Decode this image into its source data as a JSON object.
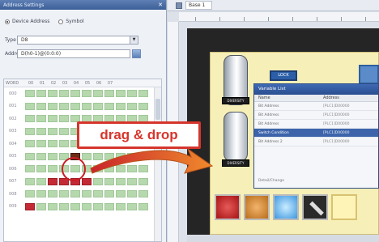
{
  "left_panel": {
    "title": "Address Settings",
    "close_glyph": "✕",
    "radio_device": "Device Address",
    "radio_symbol": "Symbol",
    "type_label": "Type",
    "type_value": "D8",
    "address_label": "Address",
    "address_value": "D(h0-1)@(0:0:0)",
    "grid_header_row": "WORD",
    "grid_col_labels": [
      "00",
      "01",
      "02",
      "03",
      "04",
      "05",
      "06",
      "07"
    ],
    "grid_row_labels": [
      "000",
      "001",
      "002",
      "003",
      "004",
      "005",
      "006",
      "007",
      "008",
      "009"
    ],
    "scrollbar": "vertical"
  },
  "right_panel": {
    "tab_title": "Base 1",
    "property_dialog": {
      "title": "Variable List",
      "col_name": "Name",
      "col_address": "Address",
      "rows": [
        {
          "name": "Bit Address",
          "addr": "[PLC1]D00000"
        },
        {
          "name": "Bit Address",
          "addr": "[PLC1]D00000"
        },
        {
          "name": "Bit Address",
          "addr": "[PLC1]D00000"
        },
        {
          "name": "Switch Condition",
          "addr": "[PLC1]D00000"
        },
        {
          "name": "Bit Address 2",
          "addr": "[PLC1]D00000"
        }
      ],
      "footer": "Detail/Change"
    },
    "cylinder_labels": [
      "DIVERSITY",
      "DIVERSITY"
    ],
    "small_button_label": "LOCK",
    "bottom_buttons": [
      "red",
      "orange",
      "blue",
      "tool",
      "pale"
    ]
  },
  "overlay": {
    "callout_text": "drag & drop",
    "arrow_color": "#e8772a",
    "accent_red": "#d6352c"
  }
}
